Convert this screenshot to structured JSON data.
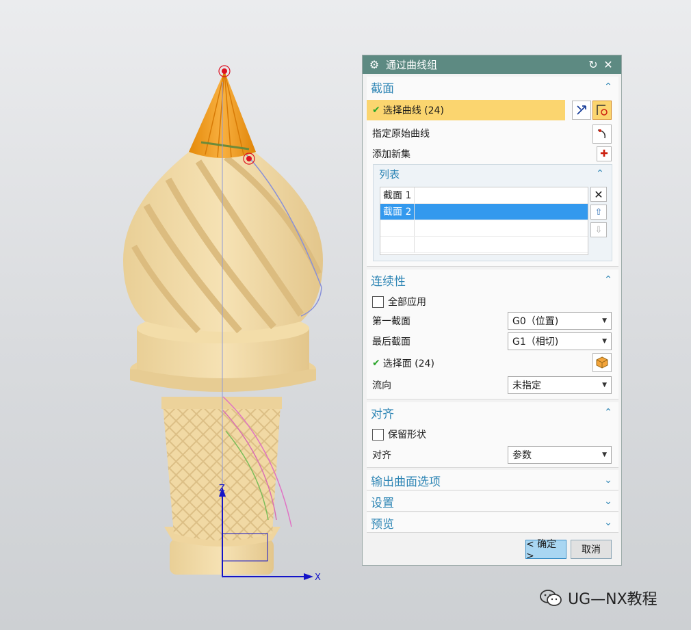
{
  "dialog": {
    "title": "通过曲线组",
    "reset_glyph": "↻",
    "close_glyph": "✕",
    "settings_icon": "gear-icon"
  },
  "section_profile": {
    "title": "截面",
    "select_curve_label": "选择曲线 (24)",
    "specify_origin_label": "指定原始曲线",
    "add_new_set_label": "添加新集",
    "list": {
      "title": "列表",
      "rows": [
        "截面 1",
        "截面 2",
        "",
        ""
      ],
      "selected_index": 1
    }
  },
  "section_continuity": {
    "title": "连续性",
    "apply_all_label": "全部应用",
    "first_section_label": "第一截面",
    "first_section_value": "G0（位置)",
    "last_section_label": "最后截面",
    "last_section_value": "G1（相切)",
    "select_face_label": "选择面 (24)",
    "flow_direction_label": "流向",
    "flow_direction_value": "未指定"
  },
  "section_alignment": {
    "title": "对齐",
    "preserve_shape_label": "保留形状",
    "alignment_label": "对齐",
    "alignment_value": "参数"
  },
  "section_output": {
    "title": "输出曲面选项"
  },
  "section_settings": {
    "title": "设置"
  },
  "section_preview": {
    "title": "预览"
  },
  "footer": {
    "ok_label": "< 确定 >",
    "cancel_label": "取消"
  },
  "axes": {
    "z_label": "Z",
    "x_label": "X"
  },
  "watermark": {
    "text": "UG—NX教程"
  },
  "colors": {
    "title_bar": "#5d8a82",
    "section_title": "#2f86b5",
    "selection_highlight": "#fbd56f",
    "list_selected": "#3399ee",
    "model_body": "#f1d9a4",
    "model_cap": "#f29a1c"
  }
}
